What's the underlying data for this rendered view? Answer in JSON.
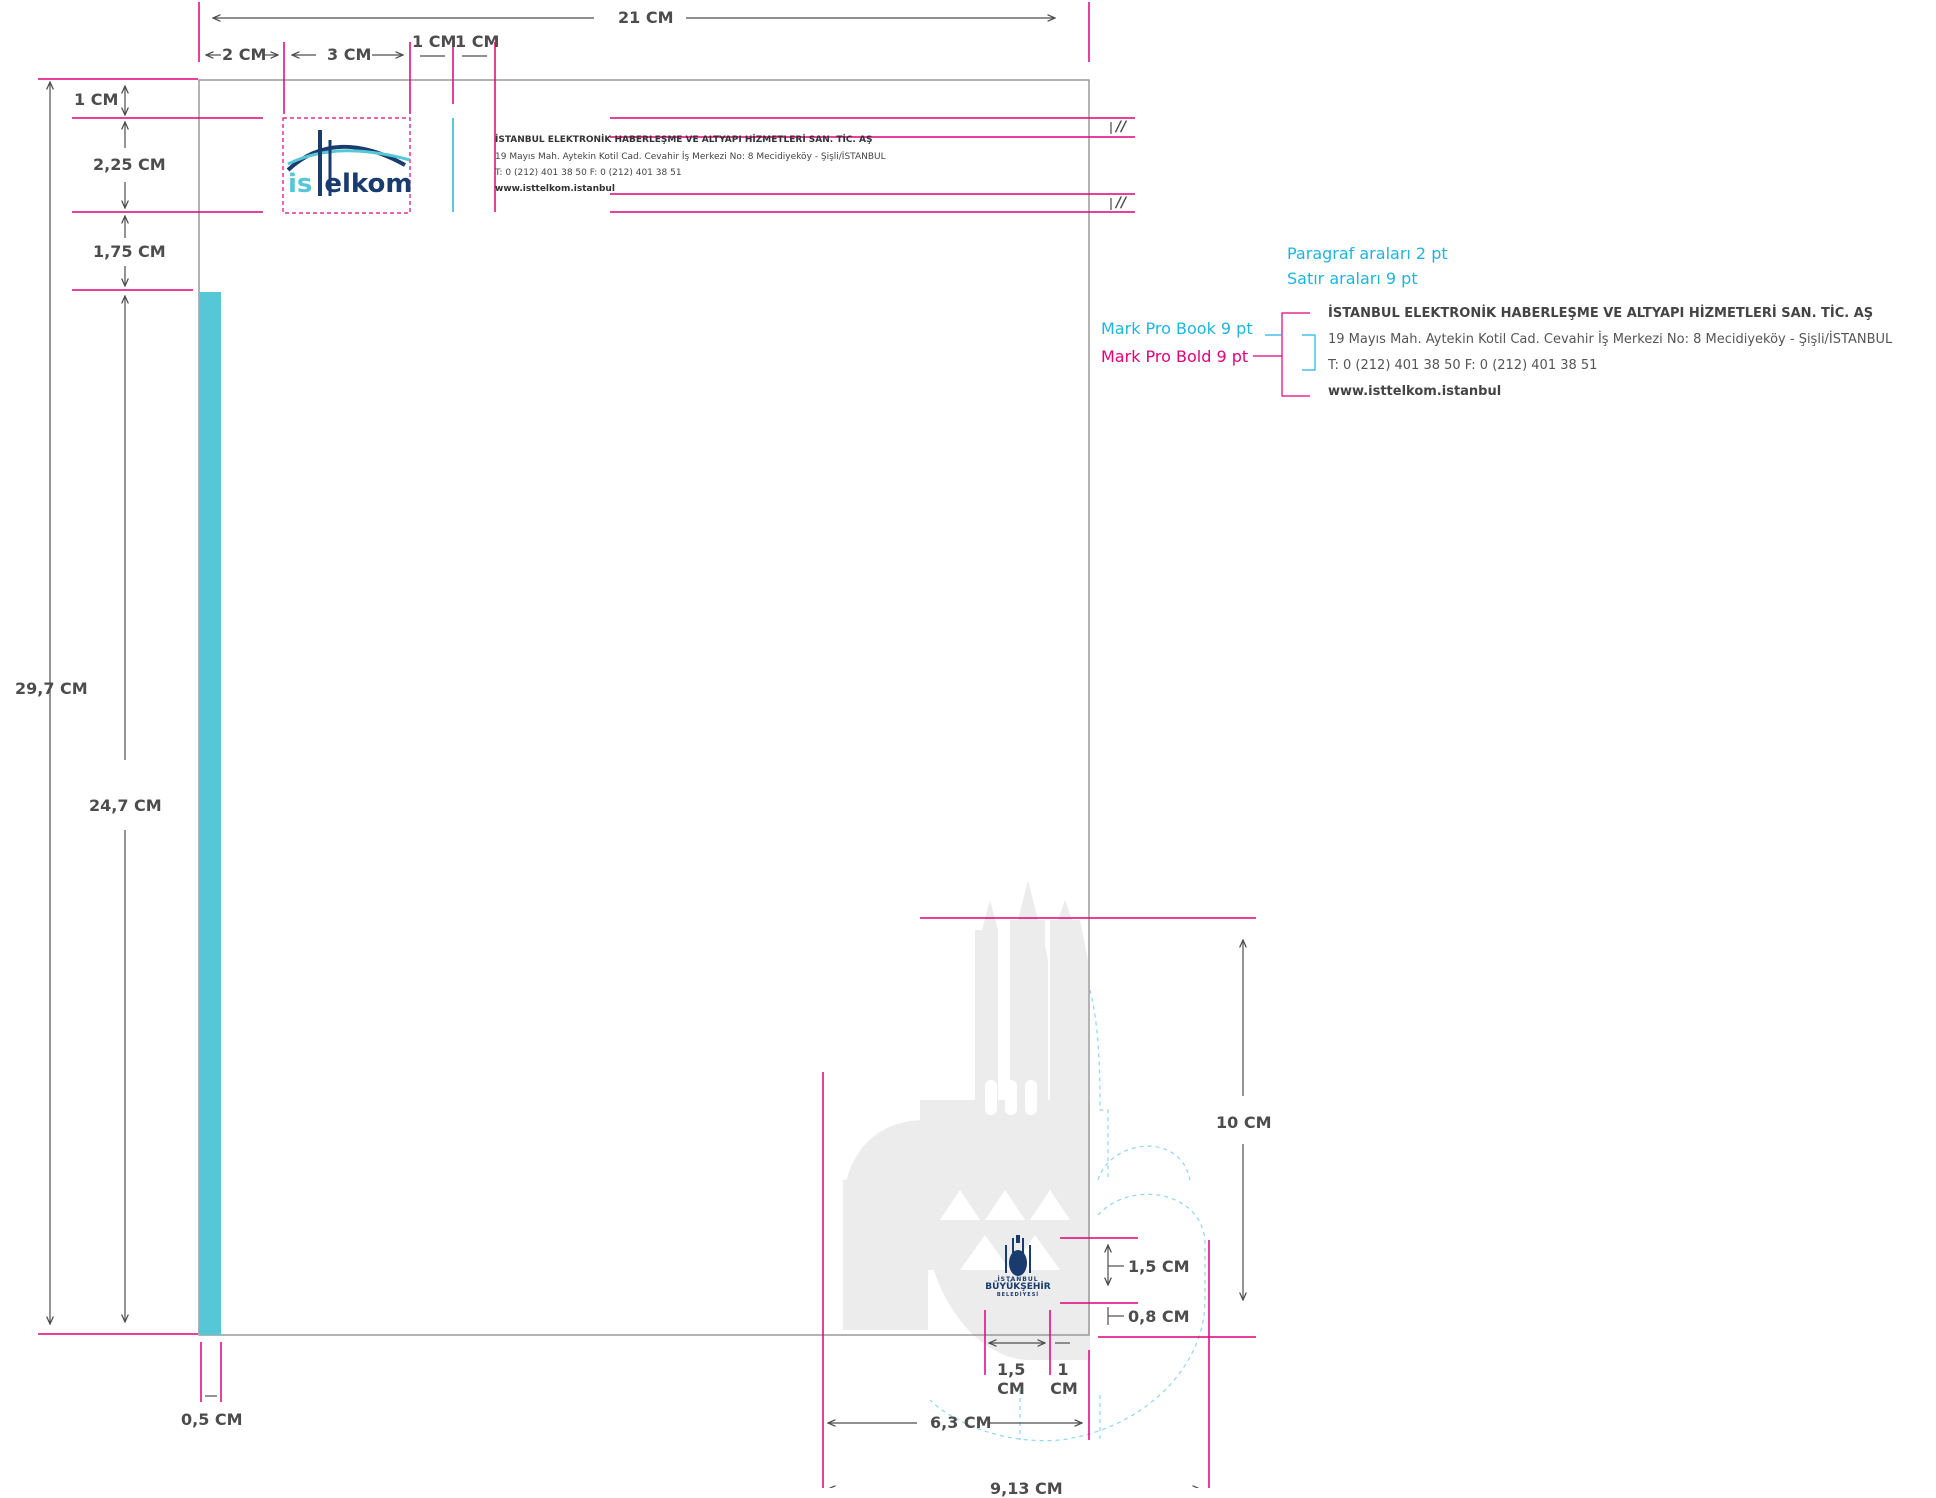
{
  "colors": {
    "magenta": "#e0007a",
    "cyan": "#1eb4e0",
    "teal_bar": "#55c7d6",
    "dark_text": "#4d4d4d",
    "navy": "#1a3b6e",
    "watermark": "#ececec",
    "page_border": "#9a9a9a"
  },
  "dimensions": {
    "width_21": "21 CM",
    "margin_2": "2 CM",
    "logo_3": "3 CM",
    "gap_1a": "1 CM",
    "gap_1b": "1 CM",
    "top_1": "1 CM",
    "header_225": "2,25 CM",
    "gap_175": "1,75 CM",
    "height_297": "29,7 CM",
    "body_247": "24,7 CM",
    "bar_05": "0,5 CM",
    "ibb_15v": "1,5 CM",
    "ibb_08": "0,8 CM",
    "ibb_15h": "1,5 CM",
    "ibb_1": "1",
    "ibb_1_cm": "CM",
    "ibb_15_cm": "CM",
    "ibb_15_num": "1,5",
    "wm_10": "10 CM",
    "wm_63": "6,3 CM",
    "wm_913": "9,13 CM"
  },
  "header": {
    "company": "İSTANBUL ELEKTRONİK HABERLEŞME VE ALTYAPI HİZMETLERİ SAN. TİC. AŞ",
    "address": "19 Mayıs Mah. Aytekin Kotil Cad. Cevahir İş Merkezi No: 8 Mecidiyeköy - Şişli/İSTANBUL",
    "phone": "T: 0 (212) 401 38 50 F: 0 (212) 401 38 51",
    "web": "www.isttelkom.istanbul"
  },
  "logo": {
    "part1": "is",
    "part2": "elkom"
  },
  "spec": {
    "paragraph": "Paragraf araları 2 pt",
    "line": "Satır araları 9 pt",
    "book": "Mark Pro Book 9 pt",
    "bold": "Mark Pro Bold 9 pt",
    "company": "İSTANBUL ELEKTRONİK HABERLEŞME VE ALTYAPI HİZMETLERİ SAN. TİC. AŞ",
    "address": "19 Mayıs Mah. Aytekin Kotil Cad. Cevahir İş Merkezi No: 8 Mecidiyeköy - Şişli/İSTANBUL",
    "phone": "T: 0 (212) 401 38 50 F: 0 (212) 401 38 51",
    "web": "www.isttelkom.istanbul"
  },
  "ibb": {
    "line1": "İSTANBUL",
    "line2": "BÜYÜKŞEHİR",
    "line3": "BELEDİYESİ"
  },
  "marks": {
    "parallel": "//"
  }
}
